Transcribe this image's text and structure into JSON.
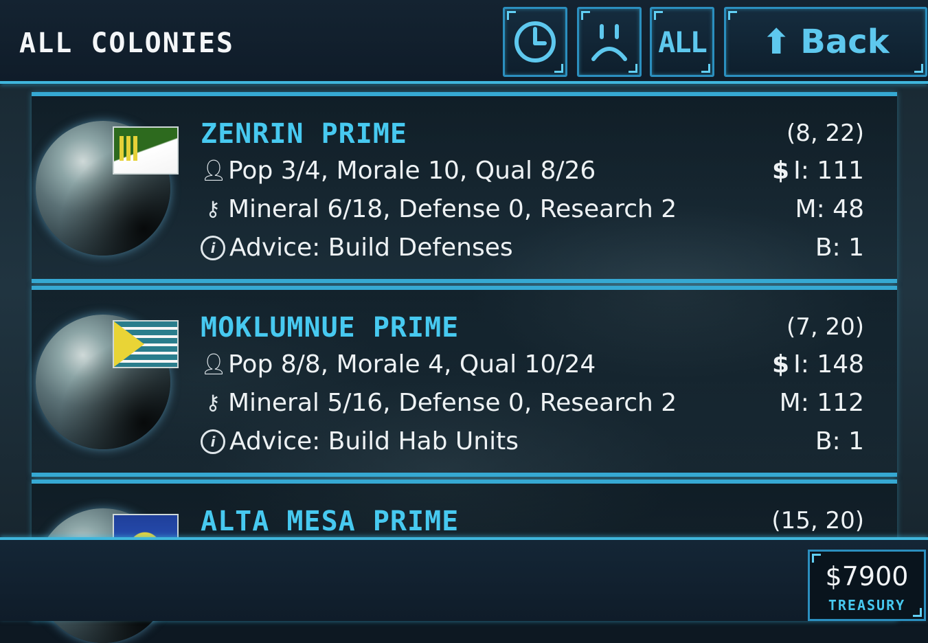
{
  "header": {
    "title": "ALL COLONIES",
    "buttons": {
      "time_icon": "clock-icon",
      "morale_icon": "sad-face-icon",
      "all_label": "ALL",
      "back_label": "Back"
    }
  },
  "colonies": [
    {
      "name": "ZENRIN PRIME",
      "coords": "(8, 22)",
      "pop_line": "Pop 3/4, Morale 10, Qual 8/26",
      "resource_line": "Mineral 6/18, Defense 0, Research 2",
      "advice_line": "Advice: Build Defenses",
      "income": "I: 111",
      "mineral": "M: 48",
      "build": "B: 1",
      "flag_colors": [
        "#2d6a1e",
        "#ffffff",
        "#e6d138"
      ]
    },
    {
      "name": "MOKLUMNUE PRIME",
      "coords": "(7, 20)",
      "pop_line": "Pop 8/8, Morale 4, Qual 10/24",
      "resource_line": "Mineral 5/16, Defense 0, Research 2",
      "advice_line": "Advice: Build Hab Units",
      "income": "I: 148",
      "mineral": "M: 112",
      "build": "B: 1",
      "flag_colors": [
        "#2a7d8c",
        "#f6f6f6",
        "#e9d436"
      ]
    },
    {
      "name": "ALTA MESA PRIME",
      "coords": "(15, 20)",
      "flag_colors": [
        "#1f3f9a",
        "#e9d436"
      ]
    }
  ],
  "footer": {
    "treasury_amount": "$7900",
    "treasury_label": "TREASURY"
  },
  "colors": {
    "accent": "#3fb6dc",
    "colony_name": "#47c9f0",
    "background": "#0d1822"
  }
}
